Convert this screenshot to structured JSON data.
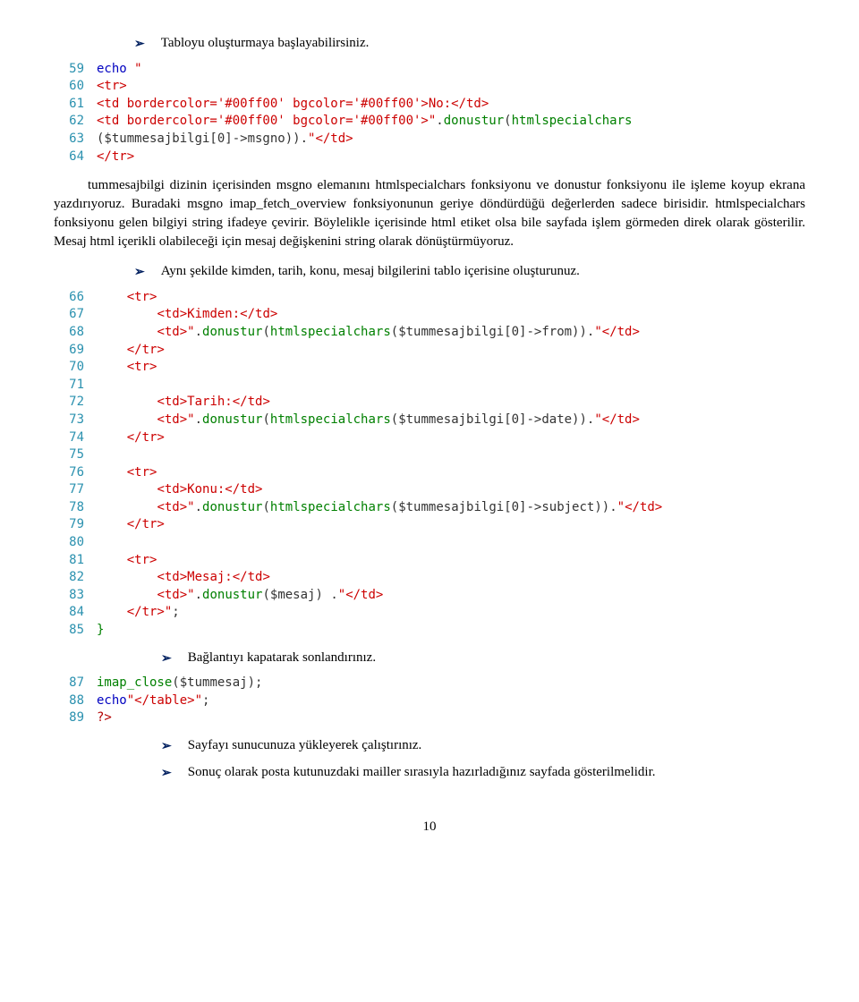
{
  "bullets": {
    "b1": "Tabloyu oluşturmaya başlayabilirsiniz.",
    "b2": "Aynı şekilde kimden, tarih, konu, mesaj bilgilerini tablo içerisine oluşturunuz.",
    "b3": "Bağlantıyı kapatarak sonlandırınız.",
    "b4": "Sayfayı sunucunuza yükleyerek çalıştırınız.",
    "b5": "Sonuç olarak posta kutunuzdaki mailler sırasıyla hazırladığınız sayfada gösterilmelidir."
  },
  "para1": "tummesajbilgi dizinin içerisinden msgno elemanını htmlspecialchars fonksiyonu ve donustur fonksiyonu ile işleme koyup ekrana yazdırıyoruz. Buradaki msgno imap_fetch_overview fonksiyonunun geriye döndürdüğü değerlerden sadece birisidir. htmlspecialchars fonksiyonu gelen bilgiyi string ifadeye çevirir. Böylelikle içerisinde html etiket olsa bile sayfada işlem görmeden direk olarak gösterilir. Mesaj html içerikli olabileceği için mesaj değişkenini string olarak dönüştürmüyoruz.",
  "code1": [
    {
      "n": "59",
      "tokens": [
        {
          "c": "kw",
          "t": "echo "
        },
        {
          "c": "str",
          "t": "\""
        }
      ]
    },
    {
      "n": "60",
      "tokens": [
        {
          "c": "str",
          "t": "<tr>"
        }
      ]
    },
    {
      "n": "61",
      "tokens": [
        {
          "c": "str",
          "t": "<td bordercolor='#00ff00' bgcolor='#00ff00'>No:</td>"
        }
      ]
    },
    {
      "n": "62",
      "tokens": [
        {
          "c": "str",
          "t": "<td bordercolor='#00ff00' bgcolor='#00ff00'>\""
        },
        {
          "c": "plain",
          "t": "."
        },
        {
          "c": "fn",
          "t": "donustur"
        },
        {
          "c": "plain",
          "t": "("
        },
        {
          "c": "fn",
          "t": "htmlspecialchars"
        }
      ]
    },
    {
      "n": "63",
      "tokens": [
        {
          "c": "plain",
          "t": "($tummesajbilgi[0]->msgno))."
        },
        {
          "c": "str",
          "t": "\"</td>"
        }
      ]
    },
    {
      "n": "64",
      "tokens": [
        {
          "c": "str",
          "t": "</tr>"
        }
      ]
    }
  ],
  "code2": [
    {
      "n": "66",
      "tokens": [
        {
          "c": "plain",
          "t": "    "
        },
        {
          "c": "str",
          "t": "<tr>"
        }
      ]
    },
    {
      "n": "67",
      "tokens": [
        {
          "c": "plain",
          "t": "        "
        },
        {
          "c": "str",
          "t": "<td>Kimden:</td>"
        }
      ]
    },
    {
      "n": "68",
      "tokens": [
        {
          "c": "plain",
          "t": "        "
        },
        {
          "c": "str",
          "t": "<td>\""
        },
        {
          "c": "plain",
          "t": "."
        },
        {
          "c": "fn",
          "t": "donustur"
        },
        {
          "c": "plain",
          "t": "("
        },
        {
          "c": "fn",
          "t": "htmlspecialchars"
        },
        {
          "c": "plain",
          "t": "($tummesajbilgi[0]->from))."
        },
        {
          "c": "str",
          "t": "\"</td>"
        }
      ]
    },
    {
      "n": "69",
      "tokens": [
        {
          "c": "plain",
          "t": "    "
        },
        {
          "c": "str",
          "t": "</tr>"
        }
      ]
    },
    {
      "n": "70",
      "tokens": [
        {
          "c": "plain",
          "t": "    "
        },
        {
          "c": "str",
          "t": "<tr>"
        }
      ]
    },
    {
      "n": "71",
      "tokens": [
        {
          "c": "plain",
          "t": " "
        }
      ]
    },
    {
      "n": "72",
      "tokens": [
        {
          "c": "plain",
          "t": "        "
        },
        {
          "c": "str",
          "t": "<td>Tarih:</td>"
        }
      ]
    },
    {
      "n": "73",
      "tokens": [
        {
          "c": "plain",
          "t": "        "
        },
        {
          "c": "str",
          "t": "<td>\""
        },
        {
          "c": "plain",
          "t": "."
        },
        {
          "c": "fn",
          "t": "donustur"
        },
        {
          "c": "plain",
          "t": "("
        },
        {
          "c": "fn",
          "t": "htmlspecialchars"
        },
        {
          "c": "plain",
          "t": "($tummesajbilgi[0]->date))."
        },
        {
          "c": "str",
          "t": "\"</td>"
        }
      ]
    },
    {
      "n": "74",
      "tokens": [
        {
          "c": "plain",
          "t": "    "
        },
        {
          "c": "str",
          "t": "</tr>"
        }
      ]
    },
    {
      "n": "75",
      "tokens": [
        {
          "c": "plain",
          "t": " "
        }
      ]
    },
    {
      "n": "76",
      "tokens": [
        {
          "c": "plain",
          "t": "    "
        },
        {
          "c": "str",
          "t": "<tr>"
        }
      ]
    },
    {
      "n": "77",
      "tokens": [
        {
          "c": "plain",
          "t": "        "
        },
        {
          "c": "str",
          "t": "<td>Konu:</td>"
        }
      ]
    },
    {
      "n": "78",
      "tokens": [
        {
          "c": "plain",
          "t": "        "
        },
        {
          "c": "str",
          "t": "<td>\""
        },
        {
          "c": "plain",
          "t": "."
        },
        {
          "c": "fn",
          "t": "donustur"
        },
        {
          "c": "plain",
          "t": "("
        },
        {
          "c": "fn",
          "t": "htmlspecialchars"
        },
        {
          "c": "plain",
          "t": "($tummesajbilgi[0]->subject))."
        },
        {
          "c": "str",
          "t": "\"</td>"
        }
      ]
    },
    {
      "n": "79",
      "tokens": [
        {
          "c": "plain",
          "t": "    "
        },
        {
          "c": "str",
          "t": "</tr>"
        }
      ]
    },
    {
      "n": "80",
      "tokens": [
        {
          "c": "plain",
          "t": " "
        }
      ]
    },
    {
      "n": "81",
      "tokens": [
        {
          "c": "plain",
          "t": "    "
        },
        {
          "c": "str",
          "t": "<tr>"
        }
      ]
    },
    {
      "n": "82",
      "tokens": [
        {
          "c": "plain",
          "t": "        "
        },
        {
          "c": "str",
          "t": "<td>Mesaj:</td>"
        }
      ]
    },
    {
      "n": "83",
      "tokens": [
        {
          "c": "plain",
          "t": "        "
        },
        {
          "c": "str",
          "t": "<td>\""
        },
        {
          "c": "plain",
          "t": "."
        },
        {
          "c": "fn",
          "t": "donustur"
        },
        {
          "c": "plain",
          "t": "($mesaj) ."
        },
        {
          "c": "str",
          "t": "\"</td>"
        }
      ]
    },
    {
      "n": "84",
      "tokens": [
        {
          "c": "plain",
          "t": "    "
        },
        {
          "c": "str",
          "t": "</tr>\""
        },
        {
          "c": "plain",
          "t": ";"
        }
      ]
    },
    {
      "n": "85",
      "tokens": [
        {
          "c": "brace",
          "t": "}"
        }
      ]
    }
  ],
  "code3": [
    {
      "n": "87",
      "tokens": [
        {
          "c": "fn",
          "t": "imap_close"
        },
        {
          "c": "plain",
          "t": "($tummesaj);"
        }
      ]
    },
    {
      "n": "88",
      "tokens": [
        {
          "c": "kw",
          "t": "echo"
        },
        {
          "c": "str",
          "t": "\"</table>\""
        },
        {
          "c": "plain",
          "t": ";"
        }
      ]
    },
    {
      "n": "89",
      "tokens": [
        {
          "c": "punct",
          "t": "?>"
        }
      ]
    }
  ],
  "pagenum": "10"
}
